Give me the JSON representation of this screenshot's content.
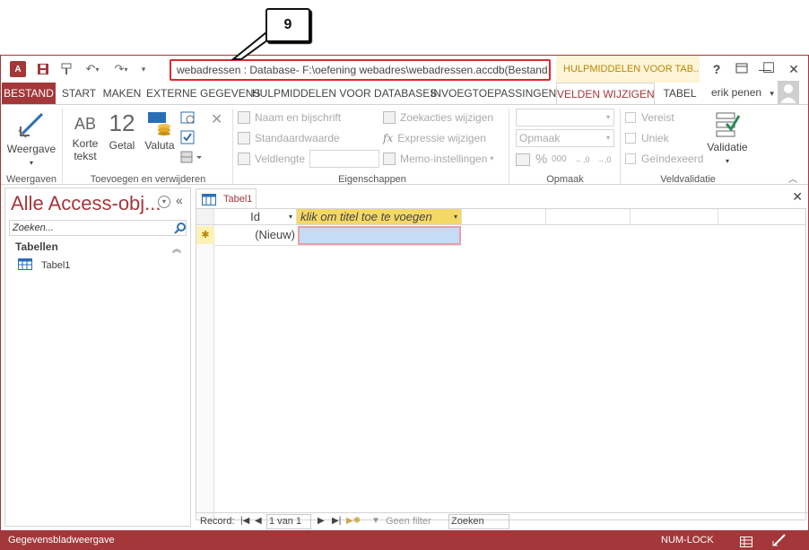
{
  "callout": {
    "number": "9"
  },
  "title": {
    "text": "webadressen : Database- F:\\oefening webadres\\webadressen.accdb(Bestand...",
    "context_tab": "HULPMIDDELEN VOOR TAB...",
    "help": "?",
    "minimize": "—",
    "maximize": "☐",
    "close": "✕"
  },
  "tabs": {
    "bestand": "BESTAND",
    "start": "START",
    "maken": "MAKEN",
    "externe": "EXTERNE GEGEVENS",
    "hulpmiddelen": "HULPMIDDELEN VOOR DATABASES",
    "invoeg": "INVOEGTOEPASSINGEN",
    "velden": "VELDEN WIJZIGEN",
    "tabel": "TABEL"
  },
  "user": {
    "name": "erik penen"
  },
  "ribbon": {
    "weergaven": {
      "button": "Weergave",
      "group": "Weergaven"
    },
    "toevoegen": {
      "ab": "AB",
      "korte_line1": "Korte",
      "korte_line2": "tekst",
      "twelve": "12",
      "getal": "Getal",
      "valuta": "Valuta",
      "group": "Toevoegen en verwijderen"
    },
    "eigenschappen": {
      "naam": "Naam en bijschrift",
      "standaard": "Standaardwaarde",
      "veldlengte": "Veldlengte",
      "zoekacties": "Zoekacties wijzigen",
      "expressie": "Expressie wijzigen",
      "memo": "Memo-instellingen",
      "group": "Eigenschappen"
    },
    "opmaak": {
      "combo2": "Opmaak",
      "percent": "%",
      "comma": "000",
      "group": "Opmaak"
    },
    "veldvalidatie": {
      "vereist": "Vereist",
      "uniek": "Uniek",
      "geindexeerd": "Geïndexeerd",
      "validatie": "Validatie",
      "group": "Veldvalidatie"
    }
  },
  "nav": {
    "title": "Alle Access-obj...",
    "search_placeholder": "Zoeken...",
    "section": "Tabellen",
    "items": [
      {
        "label": "Tabel1"
      }
    ]
  },
  "document": {
    "tab": "Tabel1",
    "close": "✕",
    "columns": [
      {
        "label": "Id"
      },
      {
        "label": "klik om titel toe te voegen"
      }
    ],
    "new_row": {
      "marker": "✱",
      "id": "(Nieuw)"
    }
  },
  "record_bar": {
    "label": "Record:",
    "position": "1 van 1",
    "filter": "Geen filter",
    "search": "Zoeken"
  },
  "status": {
    "left": "Gegevensbladweergave",
    "numlock": "NUM-LOCK"
  },
  "colors": {
    "accent": "#a4373a",
    "callout_box": "#e2272d",
    "context_bg": "#fdf5d6",
    "selected_cell": "#c5dcf6",
    "header_yellow": "#f4d866"
  }
}
